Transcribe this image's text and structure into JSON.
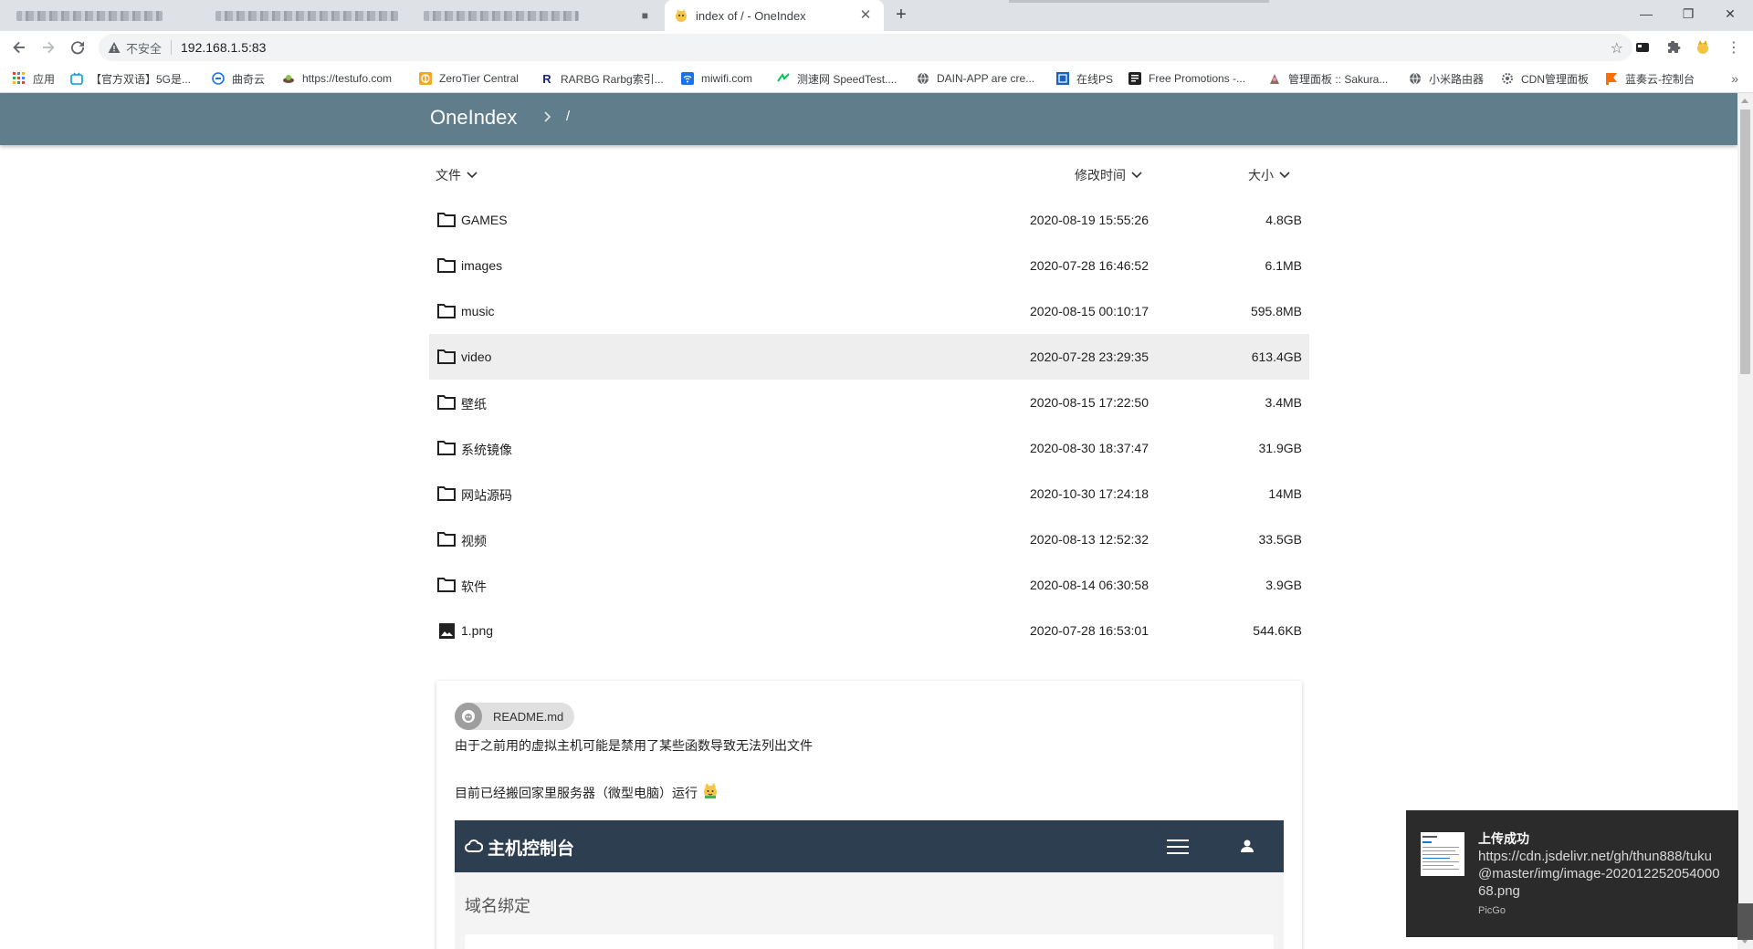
{
  "browser": {
    "active_tab_title": "index of / - OneIndex",
    "address_security_label": "不安全",
    "url": "192.168.1.5:83",
    "bookmarks": [
      {
        "label": "应用",
        "icon": "apps-grid-icon",
        "color": "#ea4335"
      },
      {
        "label": "【官方双语】5G是...",
        "icon": "bilibili-tv-icon",
        "color": "#00a1d6"
      },
      {
        "label": "曲奇云",
        "icon": "cookie-cloud-icon",
        "color": "#1a73e8"
      },
      {
        "label": "https://testufo.com",
        "icon": "ufo-icon",
        "color": "#6d4c41"
      },
      {
        "label": "ZeroTier Central",
        "icon": "zerotier-icon",
        "color": "#f5a623"
      },
      {
        "label": "RARBG Rarbg索引...",
        "icon": "rarbg-r-icon",
        "color": "#1a237e"
      },
      {
        "label": "miwifi.com",
        "icon": "wifi-icon",
        "color": "#1a73e8"
      },
      {
        "label": "测速网 SpeedTest....",
        "icon": "speedtest-icon",
        "color": "#00c853"
      },
      {
        "label": "DAIN-APP are cre...",
        "icon": "globe-icon",
        "color": "#5f6368"
      },
      {
        "label": "在线PS",
        "icon": "photoshop-icon",
        "color": "#1565c0"
      },
      {
        "label": "Free Promotions -...",
        "icon": "promotions-icon",
        "color": "#212121"
      },
      {
        "label": "管理面板 :: Sakura...",
        "icon": "sakura-icon",
        "color": "#8d6e63"
      },
      {
        "label": "小米路由器",
        "icon": "globe-icon",
        "color": "#5f6368"
      },
      {
        "label": "CDN管理面板",
        "icon": "cdn-gear-icon",
        "color": "#5f6368"
      },
      {
        "label": "蓝奏云-控制台",
        "icon": "lanzou-flag-icon",
        "color": "#ff6d00"
      }
    ]
  },
  "header": {
    "brand": "OneIndex",
    "breadcrumb_root": "/"
  },
  "list": {
    "col_name": "文件",
    "col_modified": "修改时间",
    "col_size": "大小",
    "rows": [
      {
        "name": "GAMES",
        "modified": "2020-08-19 15:55:26",
        "size": "4.8GB",
        "type": "folder"
      },
      {
        "name": "images",
        "modified": "2020-07-28 16:46:52",
        "size": "6.1MB",
        "type": "folder"
      },
      {
        "name": "music",
        "modified": "2020-08-15 00:10:17",
        "size": "595.8MB",
        "type": "folder"
      },
      {
        "name": "video",
        "modified": "2020-07-28 23:29:35",
        "size": "613.4GB",
        "type": "folder"
      },
      {
        "name": "壁纸",
        "modified": "2020-08-15 17:22:50",
        "size": "3.4MB",
        "type": "folder"
      },
      {
        "name": "系统镜像",
        "modified": "2020-08-30 18:37:47",
        "size": "31.9GB",
        "type": "folder"
      },
      {
        "name": "网站源码",
        "modified": "2020-10-30 17:24:18",
        "size": "14MB",
        "type": "folder"
      },
      {
        "name": "视频",
        "modified": "2020-08-13 12:52:32",
        "size": "33.5GB",
        "type": "folder"
      },
      {
        "name": "软件",
        "modified": "2020-08-14 06:30:58",
        "size": "3.9GB",
        "type": "folder"
      },
      {
        "name": "1.png",
        "modified": "2020-07-28 16:53:01",
        "size": "544.6KB",
        "type": "image"
      }
    ]
  },
  "readme": {
    "chip_label": "README.md",
    "line1": "由于之前用的虚拟主机可能是禁用了某些函数导致无法列出文件",
    "line2": "目前已经搬回家里服务器（微型电脑）运行",
    "embedded_title": "主机控制台",
    "embedded_subtitle": "域名绑定"
  },
  "toast": {
    "title": "上传成功",
    "body": "https://cdn.jsdelivr.net/gh/thun888/tuku@master/img/image-20201225205400068.png",
    "app": "PicGo"
  },
  "colors": {
    "appbar": "#607d8b",
    "row_hover": "#eeeeee",
    "embedded_bar": "#2c3e50",
    "toast_bg": "#2b2b2b"
  }
}
